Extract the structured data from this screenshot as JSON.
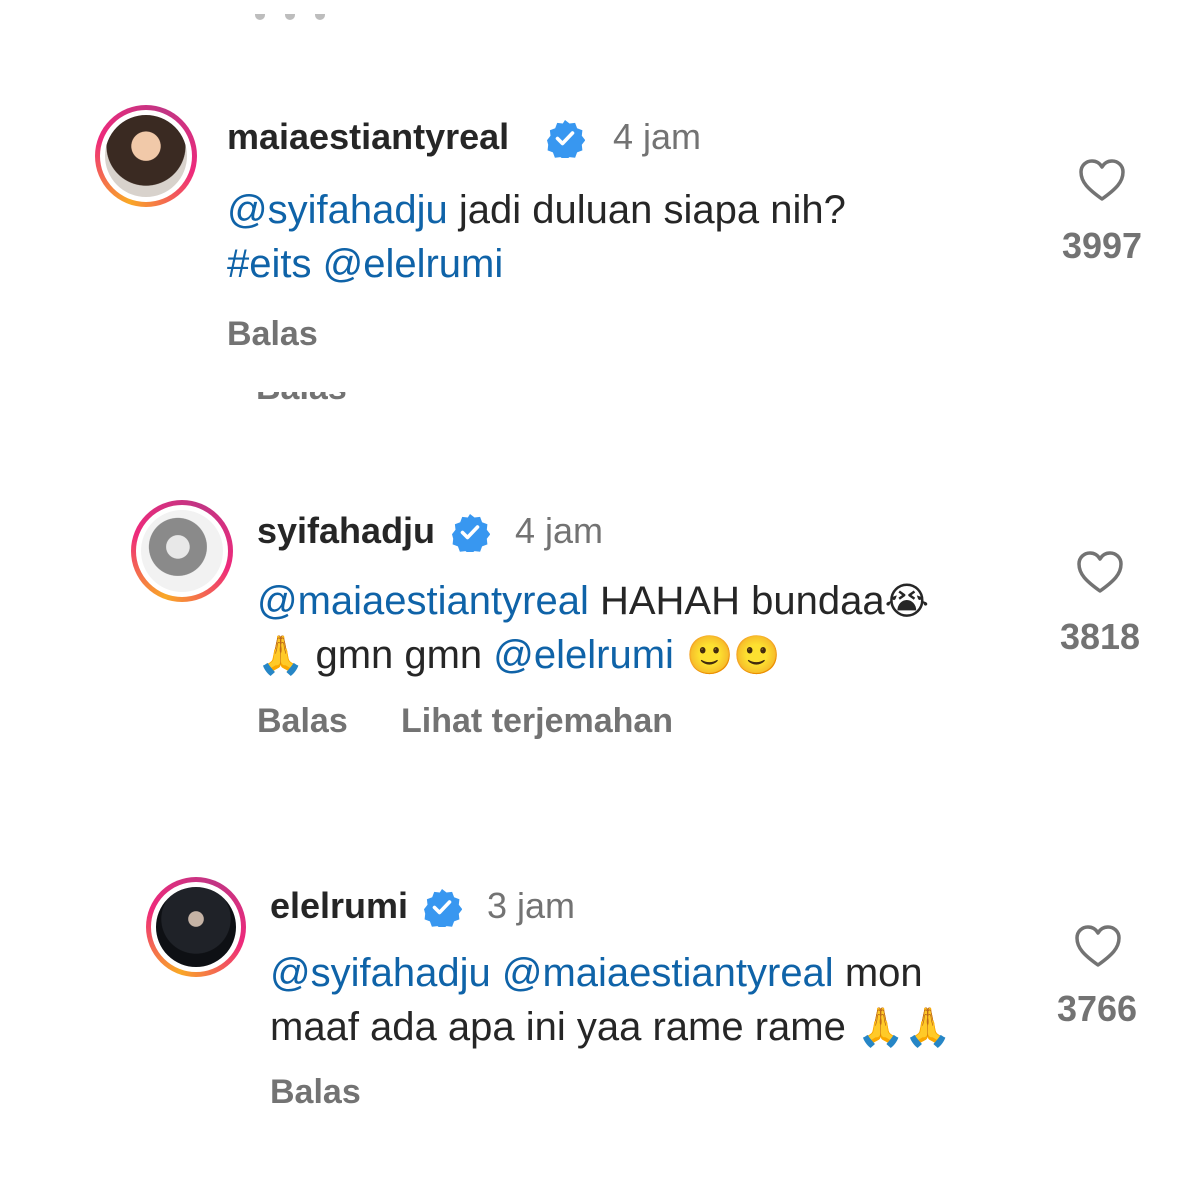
{
  "comments": [
    {
      "username": "maiaestiantyreal",
      "time": "4 jam",
      "text_parts": [
        "@syifahadju",
        " jadi duluan siapa nih?",
        "#eits @elelrumi"
      ],
      "reply_label": "Balas",
      "like_count": "3997"
    },
    {
      "username": "syifahadju",
      "time": "4 jam",
      "text_parts": [
        "@maiaestiantyreal",
        " HAHAH bundaa",
        "😭",
        "🙏",
        " gmn gmn ",
        "@elelrumi",
        " 🙂🙂"
      ],
      "reply_label": "Balas",
      "translate_label": "Lihat terjemahan",
      "like_count": "3818"
    },
    {
      "username": "elelrumi",
      "time": "3 jam",
      "text_parts": [
        "@syifahadju @maiaestiantyreal",
        " mon",
        "maaf ada apa ini yaa rame rame ",
        "🙏🙏"
      ],
      "reply_label": "Balas",
      "like_count": "3766"
    }
  ],
  "hidden_fragment": "Balas",
  "colors": {
    "mention": "#0f63a8",
    "verified": "#3897f0",
    "secondary_text": "#737373"
  },
  "icons": [
    "verified-badge-icon",
    "heart-icon"
  ]
}
